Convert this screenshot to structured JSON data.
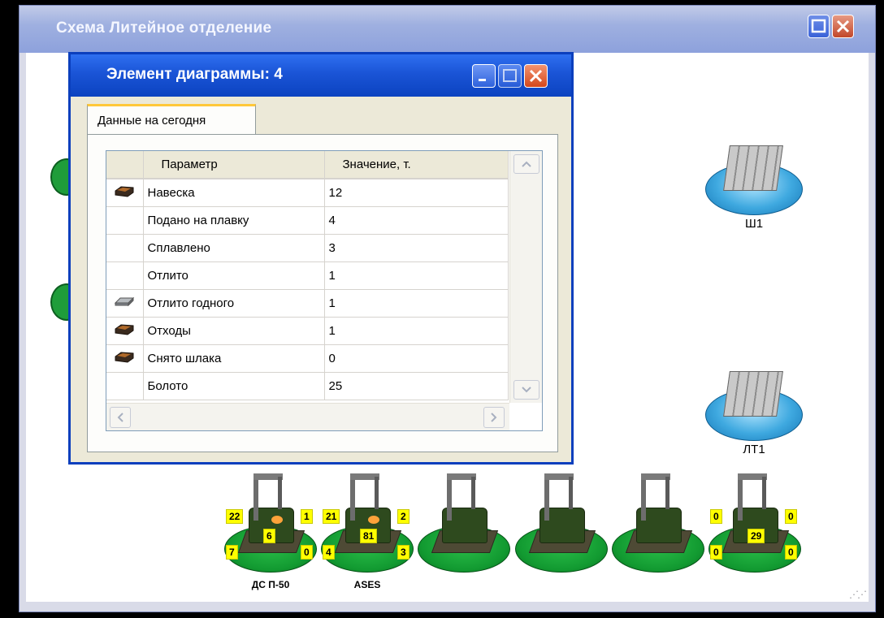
{
  "main_window": {
    "title": "Схема Литейное отделение"
  },
  "schema": {
    "storages": [
      {
        "label": "Ш1"
      },
      {
        "label": "ЛТ1"
      }
    ],
    "furnaces": [
      {
        "label": "ДС П-50",
        "tags": {
          "tl": "22",
          "tr": "1",
          "center": "6",
          "bl": "7",
          "br": "0"
        }
      },
      {
        "label": "ASES",
        "tags": {
          "tl": "21",
          "tr": "2",
          "center": "81",
          "bl": "4",
          "br": "3"
        }
      },
      {
        "label": "",
        "tags": null
      },
      {
        "label": "",
        "tags": null
      },
      {
        "label": "",
        "tags": null
      },
      {
        "label": "",
        "tags": {
          "tl": "0",
          "tr": "0",
          "center": "29",
          "bl": "0",
          "br": "0"
        }
      }
    ]
  },
  "dialog": {
    "title": "Элемент диаграммы: 4",
    "tab_label": "Данные на сегодня",
    "columns": [
      "Параметр",
      "Значение, т."
    ],
    "rows": [
      {
        "icon": "ore-icon",
        "param": "Навеска",
        "value": "12"
      },
      {
        "icon": "",
        "param": "Подано на плавку",
        "value": "4"
      },
      {
        "icon": "",
        "param": "Сплавлено",
        "value": "3"
      },
      {
        "icon": "",
        "param": "Отлито",
        "value": "1"
      },
      {
        "icon": "ingot-icon",
        "param": "Отлито годного",
        "value": "1"
      },
      {
        "icon": "ore-icon",
        "param": "Отходы",
        "value": "1"
      },
      {
        "icon": "ore-icon",
        "param": "Снято шлака",
        "value": "0"
      },
      {
        "icon": "",
        "param": "Болото",
        "value": "25"
      }
    ]
  }
}
